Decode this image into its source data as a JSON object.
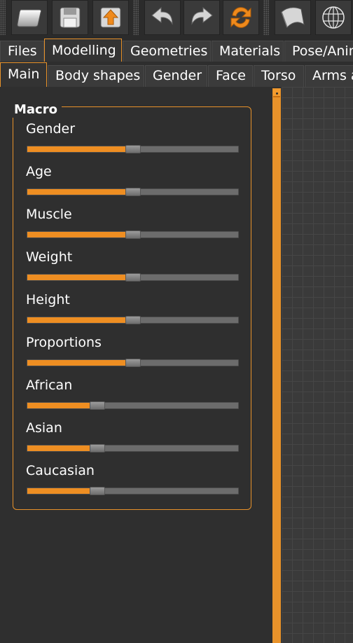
{
  "toolbar": {
    "buttons": [
      {
        "name": "new-icon"
      },
      {
        "name": "save-icon"
      },
      {
        "name": "export-icon"
      },
      {
        "name": "undo-icon"
      },
      {
        "name": "redo-icon"
      },
      {
        "name": "reset-icon"
      },
      {
        "name": "smooth-icon"
      },
      {
        "name": "wireframe-icon"
      }
    ]
  },
  "main_tabs": [
    "Files",
    "Modelling",
    "Geometries",
    "Materials",
    "Pose/Anim"
  ],
  "main_tabs_active": "Modelling",
  "sub_tabs": [
    "Main",
    "Body shapes",
    "Gender",
    "Face",
    "Torso",
    "Arms a"
  ],
  "sub_tabs_active": "Main",
  "macro": {
    "title": "Macro",
    "sliders": [
      {
        "label": "Gender",
        "value": 0.5
      },
      {
        "label": "Age",
        "value": 0.5
      },
      {
        "label": "Muscle",
        "value": 0.5
      },
      {
        "label": "Weight",
        "value": 0.5
      },
      {
        "label": "Height",
        "value": 0.5
      },
      {
        "label": "Proportions",
        "value": 0.5
      },
      {
        "label": "African",
        "value": 0.333
      },
      {
        "label": "Asian",
        "value": 0.333
      },
      {
        "label": "Caucasian",
        "value": 0.333
      }
    ]
  },
  "colors": {
    "accent": "#e8922a",
    "background": "#2f2f2f",
    "slider_fill": "#ee8e22",
    "slider_track": "#6c6c6c"
  }
}
